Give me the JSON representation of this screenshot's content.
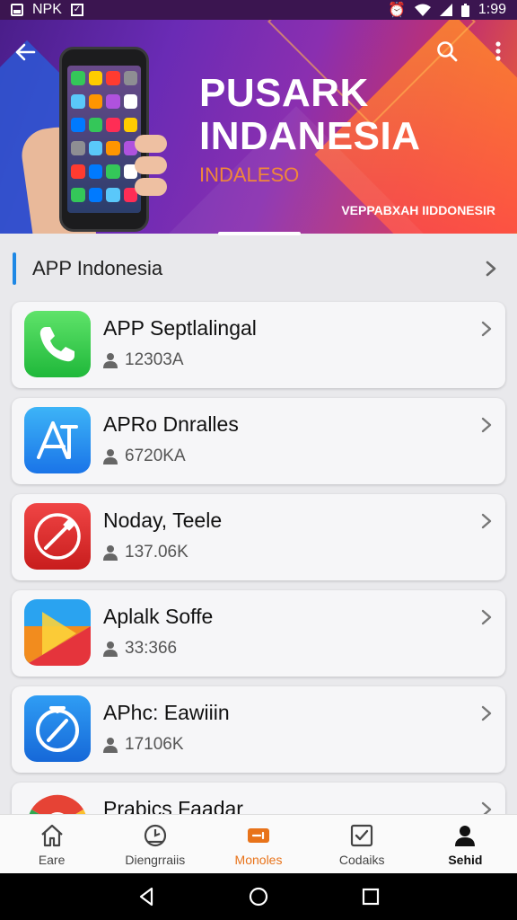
{
  "status_bar": {
    "left_text": "NPK",
    "time": "1:99"
  },
  "banner": {
    "title_line1": "PUSARK",
    "title_line2": "INDANESIA",
    "subtitle": "INDALESO",
    "tagline": "VEPPABXAH IIDDONESIR"
  },
  "section": {
    "title": "APP Indonesia"
  },
  "apps": [
    {
      "name": "APP Septlalingal",
      "count": "12303A",
      "icon": "phone-app-icon"
    },
    {
      "name": "APRo Dnralles",
      "count": "6720KA",
      "icon": "app-store-icon"
    },
    {
      "name": "Noday, Teele",
      "count": "137.06K",
      "icon": "tools-app-icon"
    },
    {
      "name": "Aplalk Soffe",
      "count": "33:366",
      "icon": "play-store-icon"
    },
    {
      "name": "APhc: Eawiiin",
      "count": "17106K",
      "icon": "safari-compass-icon"
    },
    {
      "name": "Prabics Faadar",
      "count": "",
      "icon": "chrome-browser-icon"
    }
  ],
  "bottom_nav": [
    {
      "label": "Eare",
      "icon": "home-icon"
    },
    {
      "label": "Diengrraiis",
      "icon": "clock-icon"
    },
    {
      "label": "Monoles",
      "icon": "ticket-icon"
    },
    {
      "label": "Codaiks",
      "icon": "checkbox-icon"
    },
    {
      "label": "Sehid",
      "icon": "profile-icon"
    }
  ],
  "colors": {
    "accent": "#e8731a",
    "section_bar": "#1e88e5",
    "banner_title": "#ffffff",
    "banner_subtitle": "#f0873a"
  }
}
